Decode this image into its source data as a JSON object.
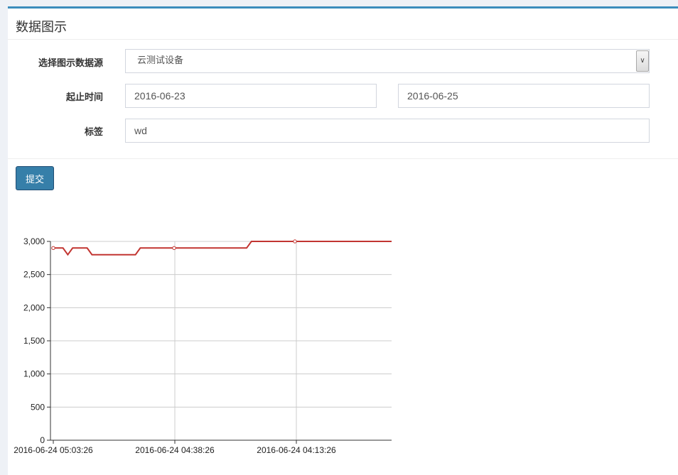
{
  "panel": {
    "title": "数据图示"
  },
  "form": {
    "source_label": "选择图示数据源",
    "source_value": "云测试设备",
    "range_label": "起止时间",
    "start_date": "2016-06-23",
    "end_date": "2016-06-25",
    "tag_label": "标签",
    "tag_value": "wd",
    "submit_label": "提交"
  },
  "colors": {
    "accent": "#3c8dbc",
    "button": "#367fa9",
    "series": "#c23531"
  },
  "chart_data": {
    "type": "line",
    "x_ticks": [
      "2016-06-24 05:03:26",
      "2016-06-24 04:38:26",
      "2016-06-24 04:13:26"
    ],
    "y_ticks": [
      "3,000",
      "2,500",
      "2,000",
      "1,500",
      "1,000",
      "500",
      "0"
    ],
    "ylim": [
      0,
      3000
    ],
    "grid": true,
    "series": [
      {
        "values": [
          2900,
          2900,
          2900,
          2800,
          2900,
          2900,
          2900,
          2900,
          2800,
          2800,
          2800,
          2800,
          2800,
          2800,
          2800,
          2800,
          2800,
          2800,
          2900,
          2900,
          2900,
          2900,
          2900,
          2900,
          2900,
          2900,
          2900,
          2900,
          2900,
          2900,
          2900,
          2900,
          2900,
          2900,
          2900,
          2900,
          2900,
          2900,
          2900,
          2900,
          2900,
          3000,
          3000,
          3000,
          3000,
          3000,
          3000,
          3000,
          3000,
          3000,
          3000,
          3000,
          3000,
          3000,
          3000,
          3000,
          3000,
          3000,
          3000,
          3000,
          3000,
          3000,
          3000,
          3000,
          3000,
          3000,
          3000,
          3000,
          3000,
          3000,
          3000
        ],
        "marker_indices": [
          0,
          25,
          50
        ]
      }
    ]
  }
}
